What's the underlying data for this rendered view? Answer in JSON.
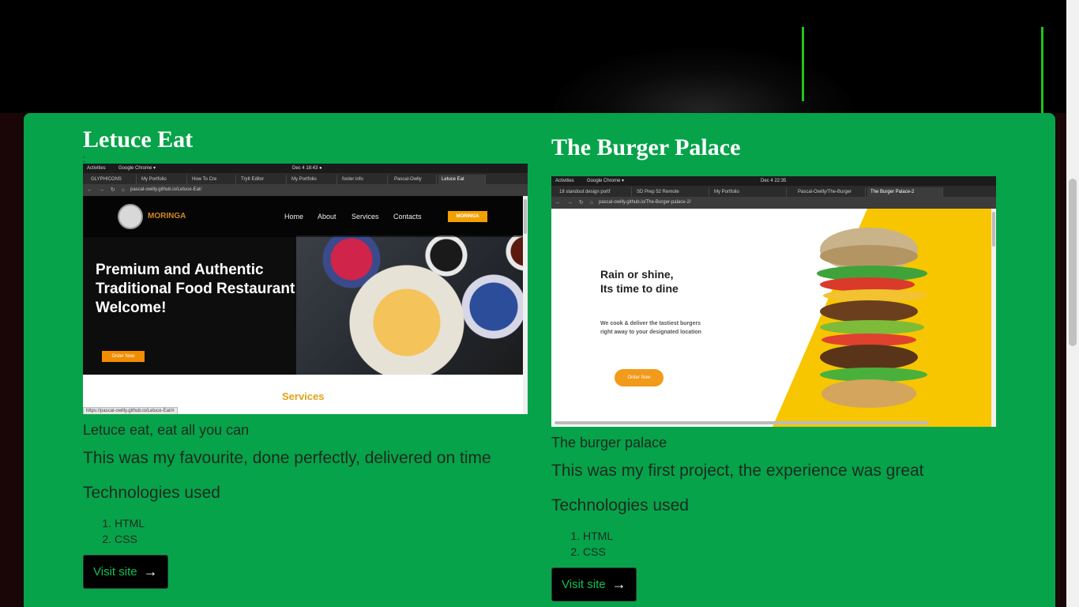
{
  "projects": [
    {
      "title": "Letuce Eat",
      "bullet": ":",
      "subtitle": "Letuce eat, eat all you can",
      "description": "This was my favourite, done perfectly, delivered on time",
      "tech_heading": "Technologies used",
      "technologies": [
        "HTML",
        "CSS"
      ],
      "visit_label": "Visit site",
      "arrow": "→",
      "screenshot": {
        "os_activities": "Activities",
        "os_app": "Google Chrome ▾",
        "os_clock": "Dec 4  18:43  ●",
        "tabs": [
          "GLYPHICONS",
          "My Portfolio",
          "How To Cre",
          "TryIt Editor",
          "My Portfolio",
          "footer info",
          "Pascal-Owlly",
          "Letuce Eat"
        ],
        "url": "pascal-owilly.github.io/Letuce-Eat/",
        "logo": "MORINGA",
        "menu": [
          "Home",
          "About",
          "Services",
          "Contacts"
        ],
        "nav_button": "MORINGA",
        "hero_line1": "Premium and Authentic",
        "hero_line2": "Traditional Food Restaurant",
        "hero_line3": "Welcome!",
        "order_button": "Order Now",
        "section_title": "Services",
        "status_url": "https://pascal-owilly.github.io/Letuce-Eat/#"
      }
    },
    {
      "title": "The Burger Palace",
      "subtitle": "The burger palace",
      "description": "This was my first project, the experience was great",
      "tech_heading": "Technologies used",
      "technologies": [
        "HTML",
        "CSS"
      ],
      "visit_label": "Visit site",
      "arrow": "→",
      "screenshot": {
        "os_activities": "Activities",
        "os_app": "Google Chrome ▾",
        "os_clock": "Dec 4  22:35",
        "tabs": [
          "18 standout design portf",
          "SD Prep 52 Remote",
          "My Portfolio",
          "Pascal-Owilly/The-Burger",
          "The Burger Palace-2"
        ],
        "url": "pascal-owilly.github.io/The-Burger-palace-2/",
        "hero_line1": "Rain or shine,",
        "hero_line2": "Its time to dine",
        "sub_line1": "We cook & deliver the tastiest burgers",
        "sub_line2": "right away to your designated location",
        "order_button": "Order Now"
      }
    }
  ],
  "colors": {
    "panel": "#06a34a",
    "background": "#000000",
    "accent_line": "#22c41a",
    "visit_text": "#10c055"
  }
}
